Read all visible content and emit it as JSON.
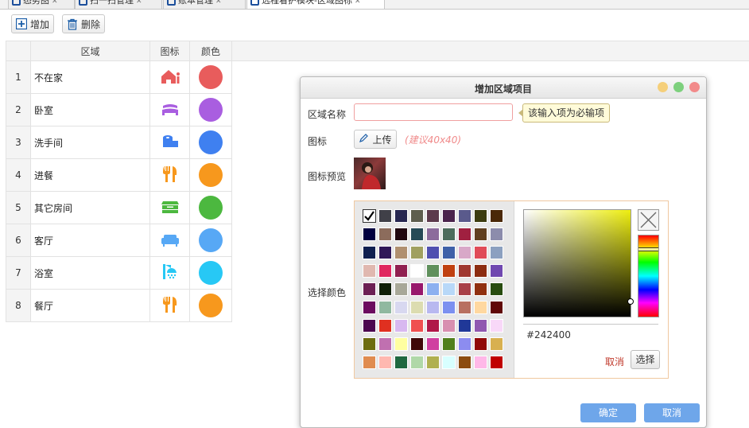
{
  "tabs": [
    {
      "label": "态势图",
      "icon": "home-icon"
    },
    {
      "label": "扫一扫管理",
      "icon": "search-icon"
    },
    {
      "label": "账本管理",
      "icon": "ledger-icon"
    },
    {
      "label": "远程看护模块-区域图标",
      "icon": "shield-icon"
    }
  ],
  "toolbar": {
    "add_label": "增加",
    "delete_label": "删除"
  },
  "grid": {
    "headers": {
      "area": "区域",
      "icon": "图标",
      "color": "颜色"
    },
    "rows": [
      {
        "num": "1",
        "area": "不在家",
        "icon": "away-home-icon",
        "color": "#e85c5c",
        "icon_color": "#e85c5c"
      },
      {
        "num": "2",
        "area": "卧室",
        "icon": "bed-icon",
        "color": "#a95ee0",
        "icon_color": "#a95ee0"
      },
      {
        "num": "3",
        "area": "洗手间",
        "icon": "toilet-paper-icon",
        "color": "#3f80f0",
        "icon_color": "#3f80f0"
      },
      {
        "num": "4",
        "area": "进餐",
        "icon": "fork-knife-icon",
        "color": "#f7981d",
        "icon_color": "#f7981d"
      },
      {
        "num": "5",
        "area": "其它房间",
        "icon": "cabinet-icon",
        "color": "#4cb83f",
        "icon_color": "#4cb83f"
      },
      {
        "num": "6",
        "area": "客厅",
        "icon": "sofa-icon",
        "color": "#57a8f5",
        "icon_color": "#57a8f5"
      },
      {
        "num": "7",
        "area": "浴室",
        "icon": "shower-icon",
        "color": "#27c8f5",
        "icon_color": "#27c8f5"
      },
      {
        "num": "8",
        "area": "餐厅",
        "icon": "fork-knife-icon",
        "color": "#f7981d",
        "icon_color": "#f7981d"
      }
    ]
  },
  "dialog": {
    "title": "增加区域项目",
    "name_label": "区域名称",
    "name_value": "",
    "required_tip": "该输入项为必输项",
    "icon_label": "图标",
    "upload_label": "上传",
    "upload_hint": "(建议40x40)",
    "preview_label": "图标预览",
    "color_label": "选择颜色",
    "ok_label": "确定",
    "cancel_label": "取消"
  },
  "color_picker": {
    "hex": "#242400",
    "cancel_label": "取消",
    "select_label": "选择",
    "selected_index": 0,
    "swatches": [
      "#ffffff",
      "#404048",
      "#262650",
      "#5e5e4e",
      "#5c3a4c",
      "#4a244c",
      "#5a5a8c",
      "#3c3c10",
      "#4a2808",
      "#000040",
      "#8c6c5c",
      "#200810",
      "#264a56",
      "#8c6c9c",
      "#4c6c5c",
      "#a02040",
      "#604020",
      "#8c8cac",
      "#102050",
      "#301858",
      "#b09070",
      "#a0a060",
      "#5050b0",
      "#3e60a8",
      "#d8a8c8",
      "#e04c58",
      "#8ca0c0",
      "#e0b8b0",
      "#e02860",
      "#902050",
      "#ffffff",
      "#60905c",
      "#c04010",
      "#a03830",
      "#8c2c10",
      "#7048b0",
      "#6c2054",
      "#102008",
      "#a8a898",
      "#98186c",
      "#8cb0f0",
      "#b8d8f8",
      "#a84048",
      "#903010",
      "#284c10",
      "#6c0c60",
      "#90b8a0",
      "#d8d8f0",
      "#dcdcb0",
      "#b8b8f0",
      "#7c90f0",
      "#b87060",
      "#ffd8a0",
      "#600808",
      "#4c0850",
      "#e03020",
      "#d8b8f0",
      "#f05050",
      "#b01848",
      "#d890b0",
      "#203898",
      "#9058b0",
      "#f8d8f8",
      "#6c6c10",
      "#c070b0",
      "#ffffa0",
      "#400808",
      "#d040a0",
      "#50801c",
      "#8c8cf0",
      "#900808",
      "#d8b050",
      "#e08c50",
      "#ffb8b0",
      "#206840",
      "#b0d8a8",
      "#b0b050",
      "#d8ffff",
      "#8c4c10",
      "#ffb8e8",
      "#c00000"
    ]
  }
}
